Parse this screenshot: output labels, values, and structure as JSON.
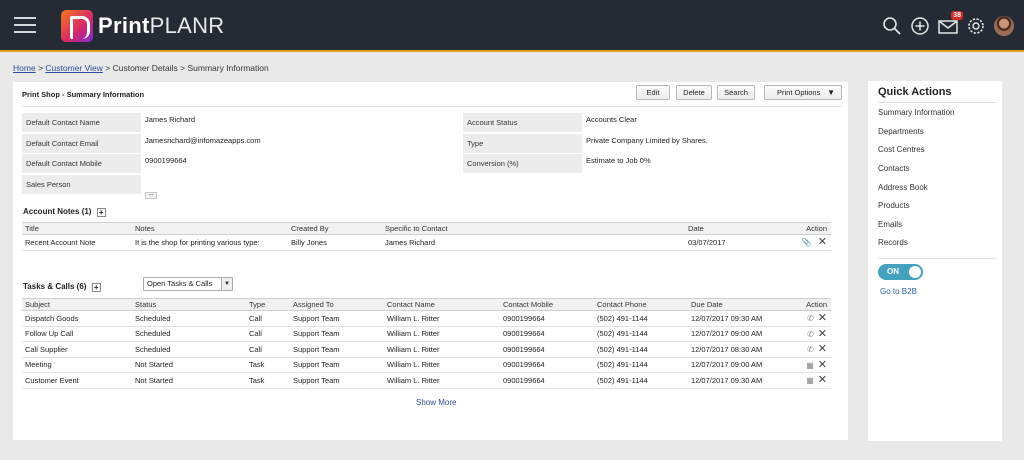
{
  "app": {
    "brand_bold": "Print",
    "brand_light": "PLANR",
    "mail_badge": "38"
  },
  "breadcrumb": {
    "home": "Home",
    "customer_view": "Customer View",
    "rest": "> Customer Details > Summary Information",
    "sep1": ">"
  },
  "panel": {
    "title": "Print Shop - Summary Information"
  },
  "toolbar": {
    "edit": "Edit",
    "delete": "Delete",
    "search": "Search",
    "print_options": "Print Options"
  },
  "contact_info": {
    "left": [
      {
        "label": "Default Contact Name",
        "value": "James Richard"
      },
      {
        "label": "Default Contact Email",
        "value": "Jamesrichard@infomazeapps.com"
      },
      {
        "label": "Default Contact Mobile",
        "value": "0900199664"
      },
      {
        "label": "Sales Person",
        "value": ""
      }
    ],
    "right": [
      {
        "label": "Account Status",
        "value": "Accounts Clear"
      },
      {
        "label": "Type",
        "value": "Private Company Limited by Shares."
      },
      {
        "label": "Conversion (%)",
        "value": "Estimate to Job 0%"
      }
    ],
    "more": "..."
  },
  "account_notes": {
    "title": "Account Notes",
    "count": "(1)",
    "add": "+",
    "columns": [
      "Title",
      "Notes",
      "Created By",
      "Specific to Contact",
      "Date",
      "Action"
    ],
    "rows": [
      [
        "Recent Account Note",
        "It is the shop for printing various type:",
        "Billy Jones",
        "James Richard",
        "03/07/2017"
      ]
    ]
  },
  "tasks": {
    "title": "Tasks & Calls",
    "count": "(6)",
    "add": "+",
    "filter": "Open Tasks & Calls",
    "columns": [
      "Subject",
      "Status",
      "Type",
      "Assigned To",
      "Contact Name",
      "Contact Mobile",
      "Contact Phone",
      "Due Date",
      "Action"
    ],
    "rows": [
      [
        "Dispatch Goods",
        "Scheduled",
        "Call",
        "Support Team",
        "William L. Ritter",
        "0900199664",
        "(502) 491-1144",
        "12/07/2017 09:30 AM"
      ],
      [
        "Follow Up Call",
        "Scheduled",
        "Call",
        "Support Team",
        "William L. Ritter",
        "0900199664",
        "(502) 491-1144",
        "12/07/2017 09:00 AM"
      ],
      [
        "Call Supplier",
        "Scheduled",
        "Call",
        "Support Team",
        "William L. Ritter",
        "0900199664",
        "(502) 491-1144",
        "12/07/2017 08:30 AM"
      ],
      [
        "Meeting",
        "Not Started",
        "Task",
        "Support Team",
        "William L. Ritter",
        "0900199664",
        "(502) 491-1144",
        "12/07/2017 09:00 AM"
      ],
      [
        "Customer Event",
        "Not Started",
        "Task",
        "Support Team",
        "William L. Ritter",
        "0900199664",
        "(502) 491-1144",
        "12/07/2017 09:30 AM"
      ]
    ],
    "show_more": "Show More"
  },
  "quick_actions": {
    "title": "Quick Actions",
    "items": [
      "Summary Information",
      "Departments",
      "Cost Centres",
      "Contacts",
      "Address Book",
      "Products",
      "Emails",
      "Records"
    ],
    "toggle": "ON",
    "b2b": "Go to B2B"
  }
}
